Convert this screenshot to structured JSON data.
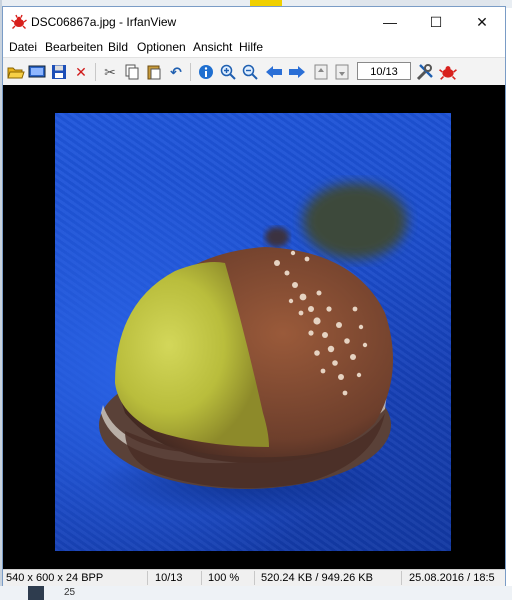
{
  "window": {
    "title": "DSC06867a.jpg - IrfanView"
  },
  "titlebar_controls": {
    "minimize": "—",
    "maximize": "☐",
    "close": "✕"
  },
  "menu": [
    "Datei",
    "Bearbeiten",
    "Bild",
    "Optionen",
    "Ansicht",
    "Hilfe"
  ],
  "toolbar": {
    "page_field": "10/13",
    "icons": [
      "open-folder-icon",
      "slideshow-icon",
      "save-icon",
      "delete-icon",
      "cut-icon",
      "copy-icon",
      "paste-icon",
      "undo-icon",
      "info-icon",
      "zoom-in-icon",
      "zoom-out-icon",
      "previous-icon",
      "next-icon",
      "first-page-icon",
      "last-page-icon",
      "settings-icon",
      "irfanview-logo-icon"
    ]
  },
  "image": {
    "subject": "chestnut on blue fabric"
  },
  "status": {
    "dimensions": "540 x 600 x 24 BPP",
    "index": "10/13",
    "zoom": "100 %",
    "size": "520.24 KB / 949.26 KB",
    "datetime": "25.08.2016 / 18:5"
  },
  "desktop": {
    "taskbar_number": "25"
  },
  "colors": {
    "accent": "#1f6fd0",
    "photo_background": "#1c4fd0",
    "window_border": "#7a9cc6"
  }
}
